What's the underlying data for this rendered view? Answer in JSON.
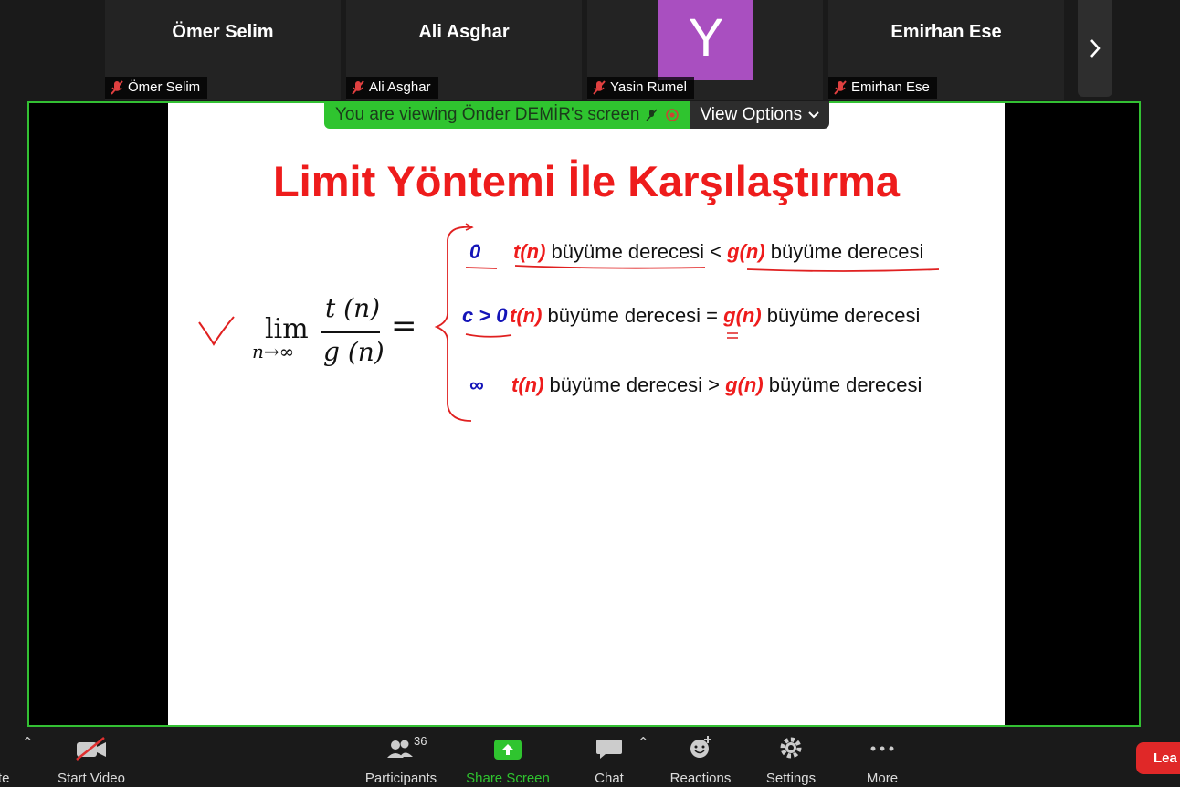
{
  "participants": [
    {
      "name": "Ömer Selim",
      "label": "Ömer Selim"
    },
    {
      "name": "Ali Asghar",
      "label": "Ali Asghar"
    },
    {
      "avatar_letter": "Y",
      "label": "Yasin Rumel"
    },
    {
      "name": "Emirhan Ese",
      "label": "Emirhan Ese"
    }
  ],
  "banner": {
    "viewing_text": "You are viewing Önder DEMİR's screen",
    "view_options": "View Options"
  },
  "slide": {
    "title": "Limit Yöntemi İle Karşılaştırma",
    "formula": {
      "lim": "lim",
      "sub": "n→∞",
      "numerator": "t (n)",
      "denominator": "g (n)",
      "equals": "="
    },
    "rows": [
      {
        "lead": "0",
        "fn1": "t(n)",
        "text1": " büyüme derecesi < ",
        "fn2": "g(n)",
        "text2": " büyüme derecesi"
      },
      {
        "lead": "c > 0",
        "fn1": "t(n)",
        "text1": "  büyüme derecesi =  ",
        "fn2": "g(n)",
        "text2": " büyüme derecesi"
      },
      {
        "lead": "∞",
        "fn1": "t(n)",
        "text1": "  büyüme derecesi >  ",
        "fn2": "g(n)",
        "text2": " büyüme derecesi"
      }
    ]
  },
  "toolbar": {
    "mute_label": "ute",
    "start_video_label": "Start Video",
    "participants_label": "Participants",
    "participants_count": "36",
    "share_screen_label": "Share Screen",
    "chat_label": "Chat",
    "reactions_label": "Reactions",
    "settings_label": "Settings",
    "more_label": "More",
    "leave_label": "Lea"
  },
  "colors": {
    "share_green": "#2fc42f",
    "border_green": "#33c033",
    "slide_red": "#ee1c1c",
    "slide_blue": "#1414b8",
    "avatar_purple": "#a94fc0",
    "leave_red": "#e02828"
  }
}
